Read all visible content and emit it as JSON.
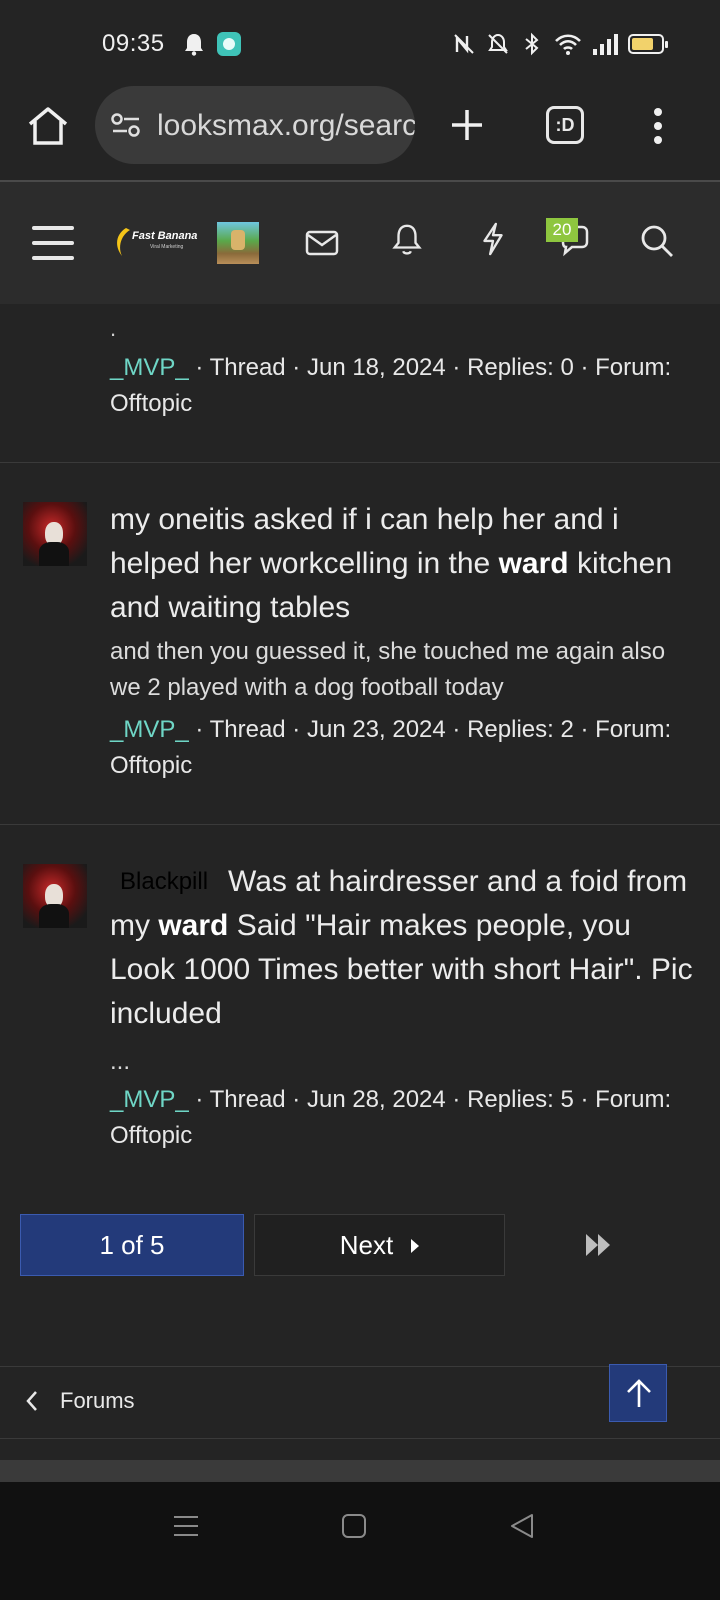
{
  "status_bar": {
    "time": "09:35",
    "battery_level": 0.75,
    "icons": [
      "bell-icon",
      "app-notification-icon",
      "nfc-icon",
      "mute-icon",
      "bluetooth-icon",
      "wifi-icon",
      "signal-icon",
      "battery-icon"
    ]
  },
  "browser": {
    "url": "looksmax.org/search",
    "tabs_label": ":D",
    "icons": [
      "home-icon",
      "site-info-icon",
      "new-tab-icon",
      "tabs-icon",
      "more-menu-icon"
    ]
  },
  "site_header": {
    "logo_text": "Fast Banana",
    "logo_subtext": "Viral Marketing",
    "badge_count": "20",
    "icons": [
      "hamburger-icon",
      "mail-icon",
      "bell-icon",
      "lightning-icon",
      "chat-icon",
      "search-icon"
    ]
  },
  "results": [
    {
      "fragment": ".",
      "user": "_MVP_",
      "meta": " · Thread · Jun 18, 2024 · Replies: 0 · Forum: ",
      "forum": "Offtopic"
    },
    {
      "title_pre": "my oneitis asked if i can help her and i helped her workcelling in the ",
      "title_bold": "ward",
      "title_post": " kitchen and waiting tables",
      "snippet": "and then you guessed it, she touched me again also we 2 played with a dog football today",
      "user": "_MVP_",
      "meta": " · Thread · Jun 23, 2024 · Replies: 2 · Forum: ",
      "forum": "Offtopic"
    },
    {
      "prefix": "Blackpill",
      "title_pre": "Was at hairdresser and a foid from my ",
      "title_bold": "ward",
      "title_post": " Said \"Hair makes people, you Look 1000 Times better with short Hair\". Pic included",
      "snippet": "...",
      "user": "_MVP_",
      "meta": " · Thread · Jun 28, 2024 · Replies: 5 · Forum: ",
      "forum": "Offtopic"
    }
  ],
  "pagination": {
    "current": "1 of 5",
    "next": "Next"
  },
  "footer": {
    "breadcrumb": "Forums"
  },
  "colors": {
    "background": "#242424",
    "header": "#2c2c2c",
    "username": "#6fd6c6",
    "accent": "#233a7a",
    "badge": "#8ec63f"
  }
}
